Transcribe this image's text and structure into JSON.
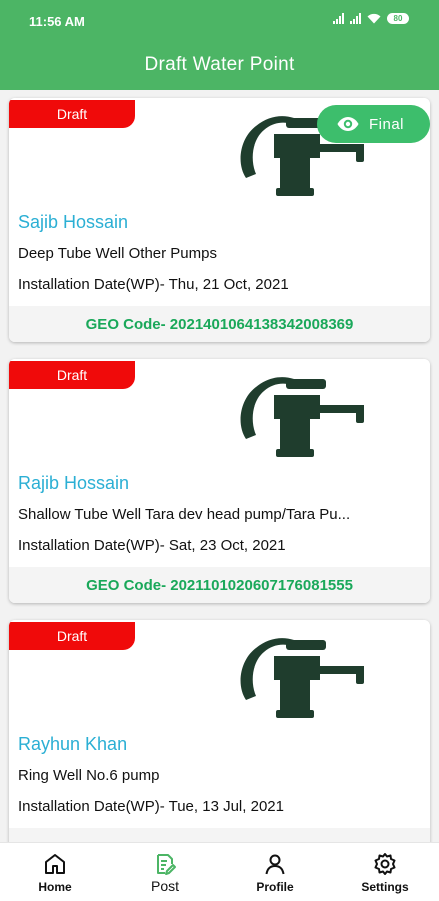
{
  "status_bar": {
    "time": "11:56 AM",
    "battery": "80"
  },
  "app_bar": {
    "title": "Draft Water Point"
  },
  "cards": [
    {
      "badge": "Draft",
      "final_label": "Final",
      "name": "Sajib Hossain",
      "type": "Deep Tube Well Other Pumps",
      "date": "Installation Date(WP)- Thu, 21 Oct, 2021",
      "geo": "GEO Code- 20214010641383420083​69"
    },
    {
      "badge": "Draft",
      "name": "Rajib Hossain",
      "type": "Shallow Tube Well Tara dev head pump/Tara Pu...",
      "date": "Installation Date(WP)- Sat, 23 Oct, 2021",
      "geo": "GEO Code- 20211010206071760815​55"
    },
    {
      "badge": "Draft",
      "name": "Rayhun Khan",
      "type": "Ring Well No.6 pump",
      "date": "Installation Date(WP)- Tue, 13 Jul, 2021",
      "geo": ""
    }
  ],
  "bottom_nav": {
    "home": "Home",
    "post": "Post",
    "profile": "Profile",
    "settings": "Settings"
  },
  "colors": {
    "primary": "#4cb565",
    "draft": "#f00a0a",
    "name": "#2bafd4",
    "geo": "#1aa85a",
    "final": "#3dbe6c"
  }
}
